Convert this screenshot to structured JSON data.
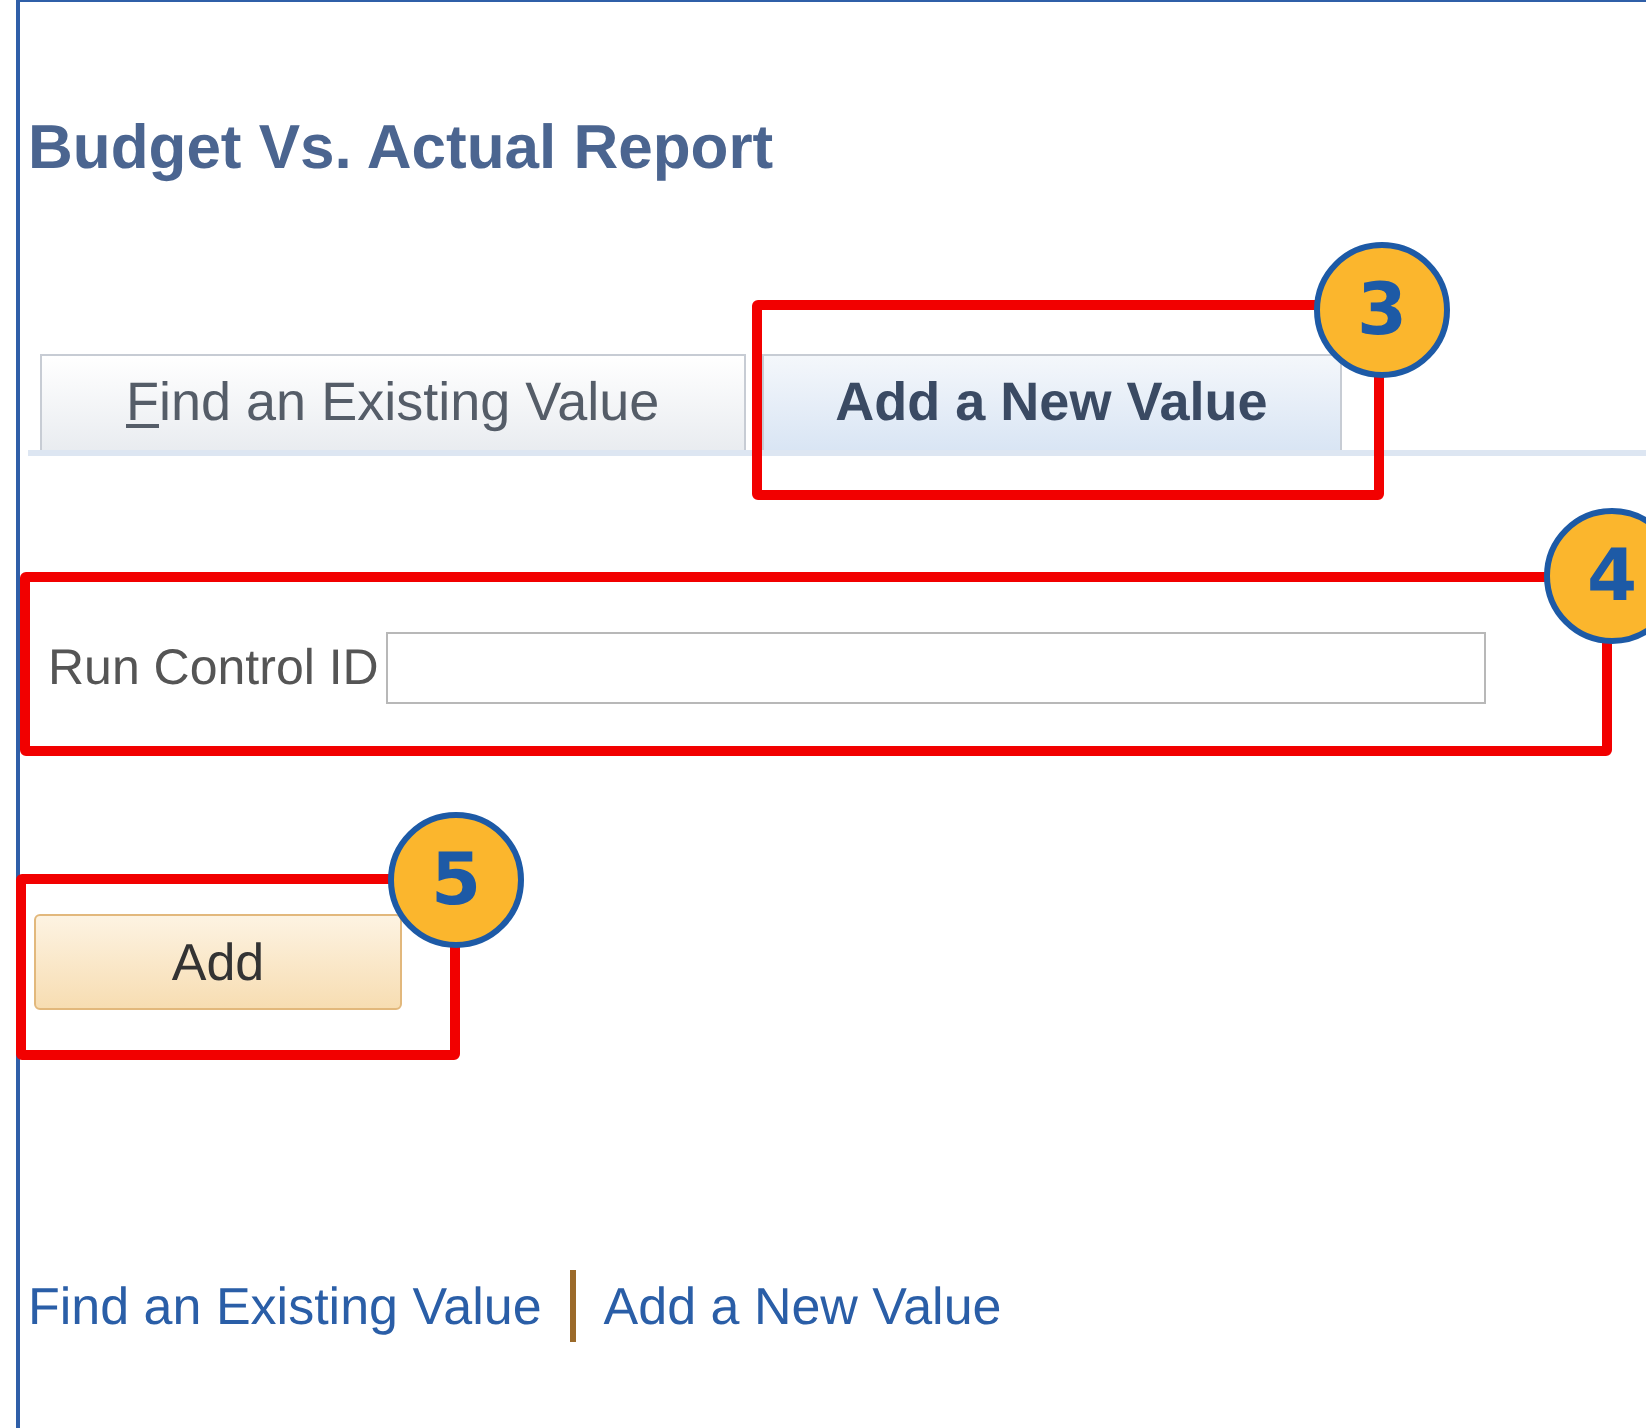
{
  "page": {
    "title": "Budget Vs. Actual Report"
  },
  "tabs": [
    {
      "label": "Find an Existing Value",
      "selected": false
    },
    {
      "label": "Add a New Value",
      "selected": true
    }
  ],
  "form": {
    "label": "Run Control ID"
  },
  "buttons": [
    "Add"
  ],
  "footer_links": [
    "Find an Existing Value",
    "Add a New Value"
  ],
  "callouts": [
    {
      "number": "3"
    },
    {
      "number": "4"
    },
    {
      "number": "5"
    }
  ]
}
